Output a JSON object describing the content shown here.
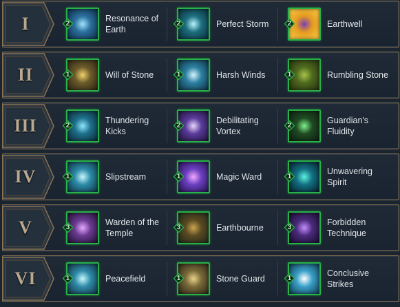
{
  "tiers": [
    {
      "numeral": "I",
      "talents": [
        {
          "name": "Resonance of Earth",
          "rank": "2",
          "icon": "resonance-of-earth-icon",
          "colors": [
            "#2b6f9c",
            "#9fe3ff",
            "#0d2a44"
          ]
        },
        {
          "name": "Perfect Storm",
          "rank": "2",
          "icon": "perfect-storm-icon",
          "colors": [
            "#1d6e7e",
            "#b7f4ff",
            "#0a2a36"
          ]
        },
        {
          "name": "Earthwell",
          "rank": "2",
          "icon": "earthwell-icon",
          "colors": [
            "#e39a20",
            "#7b3fb8",
            "#ffd24a"
          ]
        }
      ]
    },
    {
      "numeral": "II",
      "talents": [
        {
          "name": "Will of Stone",
          "rank": "1",
          "icon": "will-of-stone-icon",
          "colors": [
            "#6b5a2a",
            "#f0d36a",
            "#2a2414"
          ]
        },
        {
          "name": "Harsh Winds",
          "rank": "1",
          "icon": "harsh-winds-icon",
          "colors": [
            "#2c7fa0",
            "#d5f4ff",
            "#0f2f42"
          ]
        },
        {
          "name": "Rumbling Stone",
          "rank": "1",
          "icon": "rumbling-stone-icon",
          "colors": [
            "#4f6a1f",
            "#a6c44a",
            "#25300e"
          ]
        }
      ]
    },
    {
      "numeral": "III",
      "talents": [
        {
          "name": "Thundering Kicks",
          "rank": "2",
          "icon": "thundering-kicks-icon",
          "colors": [
            "#1d6f8a",
            "#8fe6ff",
            "#0c2836"
          ]
        },
        {
          "name": "Debilitating Vortex",
          "rank": "2",
          "icon": "debilitating-vortex-icon",
          "colors": [
            "#5a3b9a",
            "#e7d6ff",
            "#1e1238"
          ]
        },
        {
          "name": "Guardian's Fluidity",
          "rank": "2",
          "icon": "guardians-fluidity-icon",
          "colors": [
            "#1f4a22",
            "#7df08a",
            "#0c1f10"
          ]
        }
      ]
    },
    {
      "numeral": "IV",
      "talents": [
        {
          "name": "Slipstream",
          "rank": "1",
          "icon": "slipstream-icon",
          "colors": [
            "#2b8aa6",
            "#c8f6ff",
            "#0f3240"
          ]
        },
        {
          "name": "Magic Ward",
          "rank": "1",
          "icon": "magic-ward-icon",
          "colors": [
            "#6a3fc0",
            "#f2a8ff",
            "#24124a"
          ]
        },
        {
          "name": "Unwavering Spirit",
          "rank": "1",
          "icon": "unwavering-spirit-icon",
          "colors": [
            "#126f80",
            "#5cf0e0",
            "#061f2a"
          ]
        }
      ]
    },
    {
      "numeral": "V",
      "talents": [
        {
          "name": "Warden of the Temple",
          "rank": "3",
          "icon": "warden-of-the-temple-icon",
          "colors": [
            "#6a3a90",
            "#e7a8ff",
            "#1f1030"
          ]
        },
        {
          "name": "Earthbourne",
          "rank": "3",
          "icon": "earthbourne-icon",
          "colors": [
            "#5b4a22",
            "#c9a550",
            "#1c2a1c"
          ]
        },
        {
          "name": "Forbidden Technique",
          "rank": "3",
          "icon": "forbidden-technique-icon",
          "colors": [
            "#4a2a7a",
            "#c58cff",
            "#180c2c"
          ]
        }
      ]
    },
    {
      "numeral": "VI",
      "talents": [
        {
          "name": "Peacefield",
          "rank": "1",
          "icon": "peacefield-icon",
          "colors": [
            "#2e8aa8",
            "#c6f8ff",
            "#123040"
          ]
        },
        {
          "name": "Stone Guard",
          "rank": "1",
          "icon": "stone-guard-icon",
          "colors": [
            "#7a6a3a",
            "#e9d28a",
            "#2a2416"
          ]
        },
        {
          "name": "Conclusive Strikes",
          "rank": "1",
          "icon": "conclusive-strikes-icon",
          "colors": [
            "#3aa0c8",
            "#ffffff",
            "#0e3a4e"
          ]
        }
      ]
    }
  ],
  "colors": {
    "frame": "#8a7352",
    "rank_badge": "#29b14a",
    "icon_border": "#29b14a",
    "text": "#e2e6ea",
    "numeral": "#b9a890"
  }
}
